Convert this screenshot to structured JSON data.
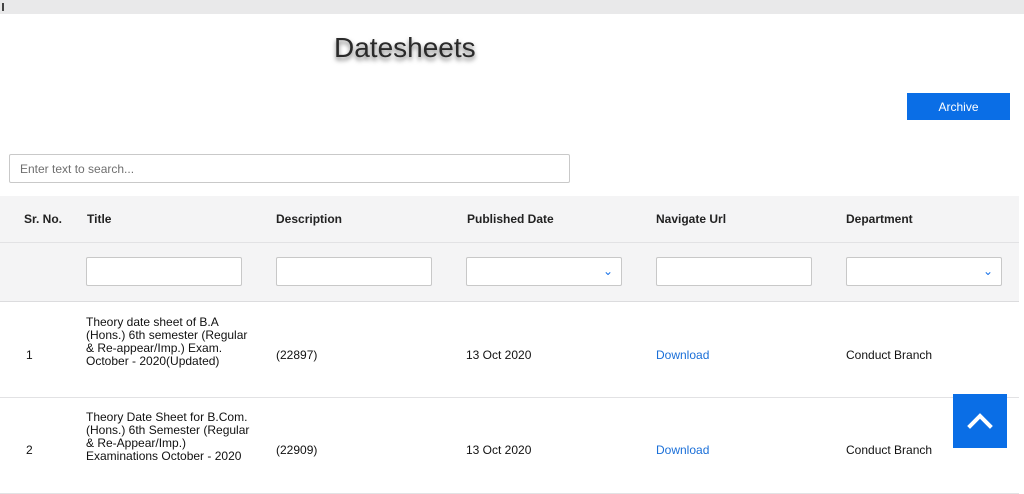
{
  "page": {
    "title": "Datesheets"
  },
  "actions": {
    "archive_label": "Archive"
  },
  "search": {
    "placeholder": "Enter text to search..."
  },
  "table": {
    "columns": [
      "Sr. No.",
      "Title",
      "Description",
      "Published Date",
      "Navigate Url",
      "Department"
    ],
    "rows": [
      {
        "sr": "1",
        "title": "Theory date sheet of B.A (Hons.) 6th semester (Regular & Re-appear/Imp.) Exam. October - 2020(Updated)",
        "description": "(22897)",
        "date": "13 Oct 2020",
        "url": "Download",
        "department": "Conduct Branch"
      },
      {
        "sr": "2",
        "title": "Theory Date Sheet for B.Com. (Hons.) 6th Semester (Regular & Re-Appear/Imp.) Examinations October - 2020",
        "description": "(22909)",
        "date": "13 Oct 2020",
        "url": "Download",
        "department": "Conduct Branch"
      }
    ]
  },
  "icons": {
    "dropdown": "chevron-down-icon",
    "scroll_top": "chevron-up-icon"
  },
  "colors": {
    "accent": "#0a6ee6",
    "link": "#1a6fd8",
    "header_bg": "#f4f4f5"
  }
}
